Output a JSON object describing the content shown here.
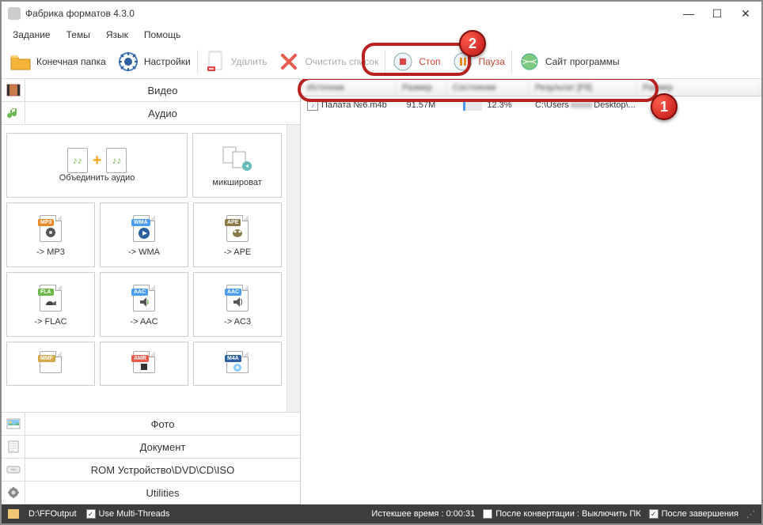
{
  "title": "Фабрика форматов 4.3.0",
  "menu": {
    "task": "Задание",
    "themes": "Темы",
    "lang": "Язык",
    "help": "Помощь"
  },
  "toolbar": {
    "output_folder": "Конечная папка",
    "settings": "Настройки",
    "delete": "Удалить",
    "clear_list": "Очистить список",
    "stop": "Стоп",
    "pause": "Пауза",
    "site": "Сайт программы"
  },
  "categories": {
    "video": "Видео",
    "audio": "Аудио",
    "photo": "Фото",
    "document": "Документ",
    "rom": "ROM Устройство\\DVD\\CD\\ISO",
    "utilities": "Utilities"
  },
  "formats": {
    "merge_audio": "Объединить аудио",
    "mix": "микшироват",
    "mp3": "-> MP3",
    "wma": "-> WMA",
    "ape": "-> APE",
    "flac": "-> FLAC",
    "aac": "-> AAC",
    "ac3": "-> AC3",
    "tags": {
      "mp3": "MP3",
      "wma": "WMA",
      "ape": "APE",
      "fla": "FLA",
      "aac": "AAC",
      "aac2": "AAC",
      "mmf": "MMF",
      "amr": "AMR",
      "m4a": "M4A"
    }
  },
  "table": {
    "headers": {
      "name": "Источник",
      "size": "Размер",
      "state": "Состояние",
      "result": "Результат [F8]",
      "extra": "Размер"
    },
    "row": {
      "filename": "Палата №6.m4b",
      "size": "91.57M",
      "percent": "12.3%",
      "progress_pct": 12.3,
      "output": "C:\\Users",
      "output_tail": "Desktop\\..."
    }
  },
  "statusbar": {
    "output_path": "D:\\FFOutput",
    "multithreads": "Use Multi-Threads",
    "elapsed_label": "Истекшее время :",
    "elapsed": "0:00:31",
    "after_conv": "После конвертации : Выключить ПК",
    "after_done": "После завершения"
  },
  "callouts": {
    "one": "1",
    "two": "2"
  }
}
